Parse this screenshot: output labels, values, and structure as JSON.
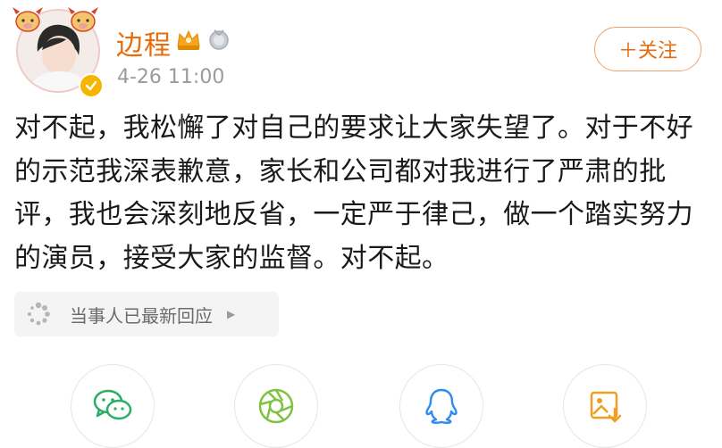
{
  "user": {
    "name": "边程",
    "post_time": "4-26 11:00",
    "verified": true
  },
  "header": {
    "follow_label": "＋关注"
  },
  "post": {
    "text": "对不起，我松懈了对自己的要求让大家失望了。对于不好的示范我深表歉意，家长和公司都对我进行了严肃的批评，我也会深刻地反省，一定严于律己，做一个踏实努力的演员，接受大家的监督。对不起。"
  },
  "response_tag": {
    "label": "当事人已最新回应"
  },
  "share": [
    {
      "name": "wechat-icon"
    },
    {
      "name": "moments-icon"
    },
    {
      "name": "qq-icon"
    },
    {
      "name": "save-image-icon"
    }
  ],
  "colors": {
    "accent_orange": "#e86b0c",
    "follow_border": "#f0a06a",
    "verified_gold": "#f7b500",
    "share_green": "#2aae67",
    "share_blue": "#2d8cf0",
    "share_yellow": "#f0a020"
  }
}
